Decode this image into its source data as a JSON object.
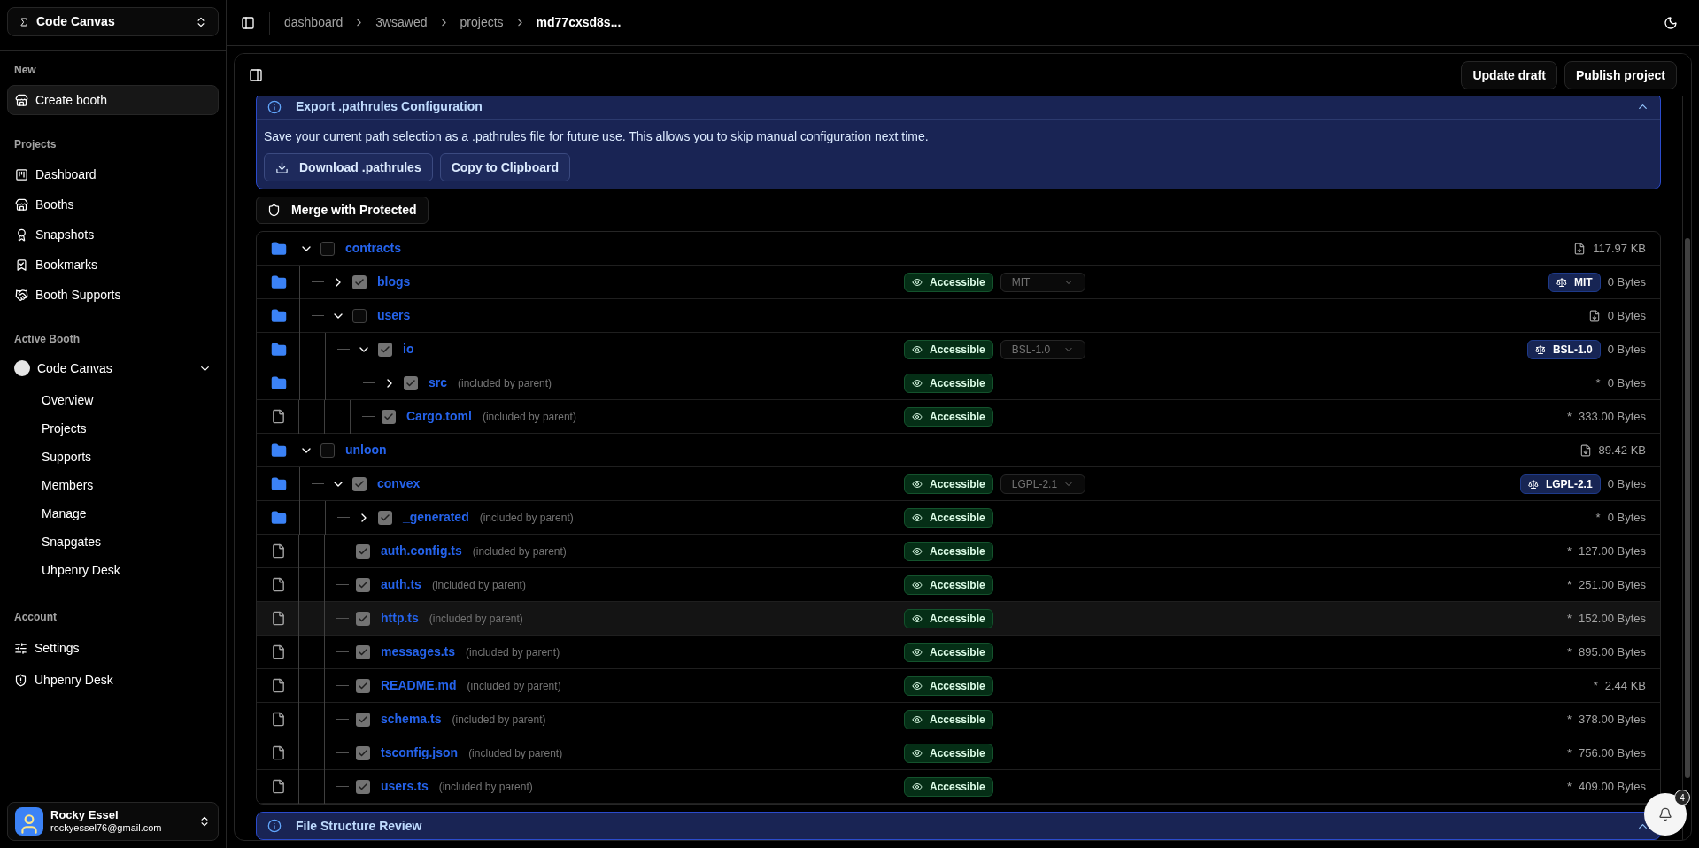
{
  "sidebar": {
    "team": "Code Canvas",
    "sections": [
      {
        "title": "New",
        "items": [
          {
            "label": "Create booth",
            "selected": true
          }
        ]
      },
      {
        "title": "Projects",
        "items": [
          {
            "label": "Dashboard",
            "selected": false
          },
          {
            "label": "Booths",
            "selected": false
          },
          {
            "label": "Snapshots",
            "selected": false
          },
          {
            "label": "Bookmarks",
            "selected": false
          },
          {
            "label": "Booth Supports",
            "selected": false
          }
        ]
      }
    ],
    "active_booth": {
      "title": "Active Booth",
      "name": "Code Canvas",
      "expanded": true,
      "items": [
        "Overview",
        "Projects",
        "Supports",
        "Members",
        "Manage",
        "Snapgates",
        "Uhpenry Desk"
      ]
    },
    "account": {
      "title": "Account",
      "items": [
        {
          "label": "Settings"
        },
        {
          "label": "Uhpenry Desk"
        }
      ]
    },
    "user": {
      "name": "Rocky Essel",
      "email": "rockyessel76@gmail.com"
    }
  },
  "breadcrumbs": [
    {
      "label": "dashboard",
      "current": false
    },
    {
      "label": "3wsawed",
      "current": false
    },
    {
      "label": "projects",
      "current": false
    },
    {
      "label": "md77cxsd8s...",
      "current": true
    }
  ],
  "toolbar": {
    "buttons": [
      "Update draft",
      "Publish project"
    ]
  },
  "export_banner": {
    "title": "Export .pathrules Configuration",
    "expanded": true,
    "text": "Save your current path selection as a .pathrules file for future use. This allows you to skip manual configuration next time.",
    "buttons": [
      "Download .pathrules",
      "Copy to Clipboard"
    ]
  },
  "merge_button": "Merge with Protected",
  "tree": [
    {
      "name": "contracts",
      "kind": "folder",
      "expanded": true,
      "checked": false,
      "hovered": false,
      "size": "117.97 KB",
      "size_icon": true,
      "children": [
        {
          "name": "blogs",
          "kind": "folder",
          "expanded": false,
          "checked": true,
          "hovered": false,
          "access": "Accessible",
          "license_select": "MIT",
          "license": "MIT",
          "size": "0 Bytes"
        },
        {
          "name": "users",
          "kind": "folder",
          "expanded": true,
          "checked": false,
          "hovered": false,
          "size": "0 Bytes",
          "size_icon": true,
          "children": [
            {
              "name": "io",
              "kind": "folder",
              "expanded": true,
              "checked": true,
              "hovered": false,
              "access": "Accessible",
              "license_select": "BSL-1.0",
              "license": "BSL-1.0",
              "size": "0 Bytes",
              "children": [
                {
                  "name": "src",
                  "kind": "folder",
                  "expanded": false,
                  "checked": true,
                  "hovered": false,
                  "note": "(included by parent)",
                  "access": "Accessible",
                  "size_mark": "*",
                  "size": "0 Bytes"
                },
                {
                  "name": "Cargo.toml",
                  "kind": "file",
                  "checked": true,
                  "hovered": false,
                  "note": "(included by parent)",
                  "access": "Accessible",
                  "size_mark": "*",
                  "size": "333.00 Bytes"
                }
              ]
            }
          ]
        }
      ]
    },
    {
      "name": "unloon",
      "kind": "folder",
      "expanded": true,
      "checked": false,
      "hovered": false,
      "size": "89.42 KB",
      "size_icon": true,
      "children": [
        {
          "name": "convex",
          "kind": "folder",
          "expanded": true,
          "checked": true,
          "hovered": false,
          "access": "Accessible",
          "license_select": "LGPL-2.1",
          "license": "LGPL-2.1",
          "size": "0 Bytes",
          "children": [
            {
              "name": "_generated",
              "kind": "folder",
              "expanded": false,
              "checked": true,
              "hovered": false,
              "note": "(included by parent)",
              "access": "Accessible",
              "size_mark": "*",
              "size": "0 Bytes"
            },
            {
              "name": "auth.config.ts",
              "kind": "file",
              "checked": true,
              "hovered": false,
              "note": "(included by parent)",
              "access": "Accessible",
              "size_mark": "*",
              "size": "127.00 Bytes"
            },
            {
              "name": "auth.ts",
              "kind": "file",
              "checked": true,
              "hovered": false,
              "note": "(included by parent)",
              "access": "Accessible",
              "size_mark": "*",
              "size": "251.00 Bytes"
            },
            {
              "name": "http.ts",
              "kind": "file",
              "checked": true,
              "hovered": true,
              "note": "(included by parent)",
              "access": "Accessible",
              "size_mark": "*",
              "size": "152.00 Bytes"
            },
            {
              "name": "messages.ts",
              "kind": "file",
              "checked": true,
              "hovered": false,
              "note": "(included by parent)",
              "access": "Accessible",
              "size_mark": "*",
              "size": "895.00 Bytes"
            },
            {
              "name": "README.md",
              "kind": "file",
              "checked": true,
              "hovered": false,
              "note": "(included by parent)",
              "access": "Accessible",
              "size_mark": "*",
              "size": "2.44 KB"
            },
            {
              "name": "schema.ts",
              "kind": "file",
              "checked": true,
              "hovered": false,
              "note": "(included by parent)",
              "access": "Accessible",
              "size_mark": "*",
              "size": "378.00 Bytes"
            },
            {
              "name": "tsconfig.json",
              "kind": "file",
              "checked": true,
              "hovered": false,
              "note": "(included by parent)",
              "access": "Accessible",
              "size_mark": "*",
              "size": "756.00 Bytes"
            },
            {
              "name": "users.ts",
              "kind": "file",
              "checked": true,
              "hovered": false,
              "note": "(included by parent)",
              "access": "Accessible",
              "size_mark": "*",
              "size": "409.00 Bytes"
            }
          ]
        }
      ]
    }
  ],
  "review_banner": {
    "title": "File Structure Review",
    "expanded": true
  },
  "notifications": {
    "count": "4"
  }
}
